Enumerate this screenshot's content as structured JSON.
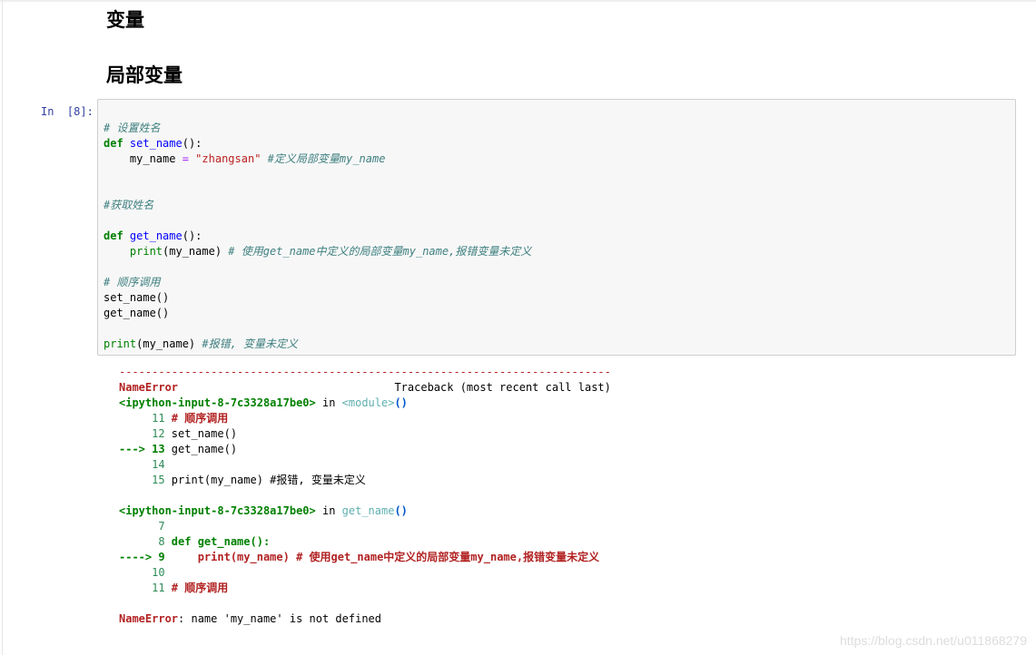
{
  "headings": {
    "h_variables": "变量",
    "h_local_variables": "局部变量"
  },
  "cell": {
    "prompt": "In  [8]:"
  },
  "code": [
    "# 设置姓名",
    "def set_name():",
    "    my_name = \"zhangsan\" #定义局部变量my_name",
    "",
    "",
    "#获取姓名",
    "",
    "def get_name():",
    "    print(my_name) # 使用get_name中定义的局部变量my_name,报错变量未定义",
    "",
    "# 顺序调用",
    "set_name()",
    "get_name()",
    "",
    "print(my_name) #报错, 变量未定义"
  ],
  "traceback": {
    "rule": "---------------------------------------------------------------------------",
    "error_name": "NameError",
    "header_right": "Traceback (most recent call last)",
    "frame1_loc": "<ipython-input-8-7c3328a17be0>",
    "frame1_in": " in ",
    "frame1_func": "<module>",
    "frame1_paren": "()",
    "frame1_lines": [
      {
        "no": "     11 ",
        "text": "# 顺序调用"
      },
      {
        "no": "     12 ",
        "text": "set_name()"
      },
      {
        "no": "---> 13 ",
        "text": "get_name()"
      },
      {
        "no": "     14 ",
        "text": ""
      },
      {
        "no": "     15 ",
        "text": "print(my_name) #报错, 变量未定义"
      }
    ],
    "frame2_loc": "<ipython-input-8-7c3328a17be0>",
    "frame2_in": " in ",
    "frame2_func": "get_name",
    "frame2_paren": "()",
    "frame2_lines": [
      {
        "no": "      7 ",
        "text": ""
      },
      {
        "no": "      8 ",
        "text": "def get_name():"
      },
      {
        "no": "----> 9 ",
        "text": "    print(my_name) # 使用get_name中定义的局部变量my_name,报错变量未定义"
      },
      {
        "no": "     10 ",
        "text": ""
      },
      {
        "no": "     11 ",
        "text": "# 顺序调用"
      }
    ],
    "final_name": "NameError",
    "final_msg": ": name 'my_name' is not defined"
  },
  "watermark": "https://blog.csdn.net/u011868279"
}
